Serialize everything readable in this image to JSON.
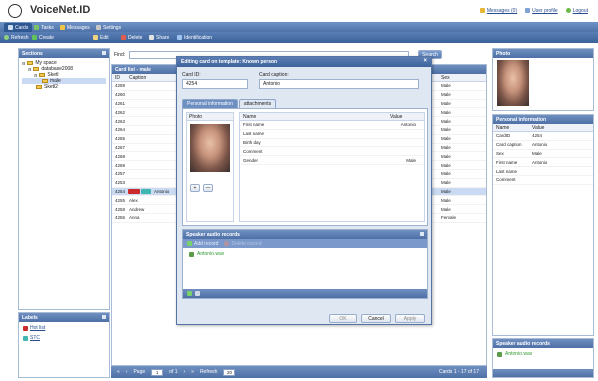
{
  "app": {
    "title": "VoiceNet.ID"
  },
  "header_links": {
    "messages": "Messages (0)",
    "profile": "User profile",
    "logout": "Logout"
  },
  "tabs": [
    {
      "label": "Cards",
      "active": true
    },
    {
      "label": "Tasks"
    },
    {
      "label": "Messages"
    },
    {
      "label": "Settings"
    }
  ],
  "toolbar": {
    "refresh": "Refresh",
    "create": "Create",
    "edit": "Edit",
    "delete": "Delete",
    "share": "Share",
    "identification": "Identification"
  },
  "sections": {
    "title": "Sections",
    "tree": [
      "My space",
      "database2008",
      "Sketl",
      "male",
      "Sketl2"
    ]
  },
  "labels": {
    "title": "Labels",
    "items": [
      "Hot list",
      "STC"
    ]
  },
  "find": {
    "label": "Find:",
    "button": "Search"
  },
  "cardlist": {
    "title": "Card list - male",
    "columns": [
      "ID",
      "Caption"
    ],
    "sex_header": "Sex",
    "rows": [
      {
        "id": "4259",
        "caption": "",
        "sex": "Male"
      },
      {
        "id": "4260",
        "caption": "",
        "sex": "Male"
      },
      {
        "id": "4261",
        "caption": "",
        "sex": "Male"
      },
      {
        "id": "4262",
        "caption": "",
        "sex": "Male"
      },
      {
        "id": "4263",
        "caption": "",
        "sex": "Male"
      },
      {
        "id": "4264",
        "caption": "",
        "sex": "Male"
      },
      {
        "id": "4265",
        "caption": "",
        "sex": "Male"
      },
      {
        "id": "4267",
        "caption": "",
        "sex": "Male"
      },
      {
        "id": "4268",
        "caption": "",
        "sex": "Male"
      },
      {
        "id": "4269",
        "caption": "",
        "sex": "Male"
      },
      {
        "id": "4257",
        "caption": "",
        "sex": "Male"
      },
      {
        "id": "4253",
        "caption": "",
        "sex": "Male"
      },
      {
        "id": "4254",
        "caption": "Antonio",
        "sex": "Male",
        "selected": true
      },
      {
        "id": "4255",
        "caption": "Alex",
        "sex": "Male"
      },
      {
        "id": "4258",
        "caption": "Andrew",
        "sex": "Male"
      },
      {
        "id": "4256",
        "caption": "Anna",
        "sex": "Female"
      }
    ]
  },
  "statusbar": {
    "page_label": "Page",
    "page_value": "1",
    "of_label": "of 1",
    "refresh_label": "Refresh",
    "per_page": "20",
    "summary": "Cards 1 - 17 of 17"
  },
  "dialog": {
    "title": "Editing card on template: Known person",
    "card_id_label": "Card ID:",
    "card_id_value": "4254",
    "card_caption_label": "Card caption:",
    "card_caption_value": "Antonio",
    "tabs": [
      "Personal information",
      "attachments"
    ],
    "photo_label": "Photo",
    "table_headers": [
      "Name",
      "Value"
    ],
    "fields": [
      {
        "name": "First name",
        "value": "Antonio"
      },
      {
        "name": "Last name",
        "value": ""
      },
      {
        "name": "Birth day",
        "value": ""
      },
      {
        "name": "Comment",
        "value": ""
      },
      {
        "name": "Gender",
        "value": "Male"
      }
    ],
    "add_btn": "+",
    "remove_btn": "—",
    "audio_title": "Speaker audio records",
    "add_record": "Add record",
    "delete_record": "Delete record",
    "audio_item": "Antonio.wav",
    "btn_ok": "OK",
    "btn_cancel": "Cancel",
    "btn_apply": "Apply"
  },
  "right": {
    "photo_title": "Photo",
    "info_title": "Personal information",
    "headers": [
      "Name",
      "Value"
    ],
    "rows": [
      {
        "name": "CardID",
        "value": "4254"
      },
      {
        "name": "Card caption",
        "value": "Antonio"
      },
      {
        "name": "Sex",
        "value": "Male"
      },
      {
        "name": "First name",
        "value": "Antonio"
      },
      {
        "name": "Last name",
        "value": ""
      },
      {
        "name": "Comment",
        "value": ""
      }
    ],
    "audio_title": "Speaker audio records",
    "audio_item": "Antonio.wav"
  },
  "colors": {
    "accent": "#4e70a6",
    "selected_row": "#c9daf2",
    "label_red": "#cc2b2b",
    "label_teal": "#3fb6b0"
  }
}
